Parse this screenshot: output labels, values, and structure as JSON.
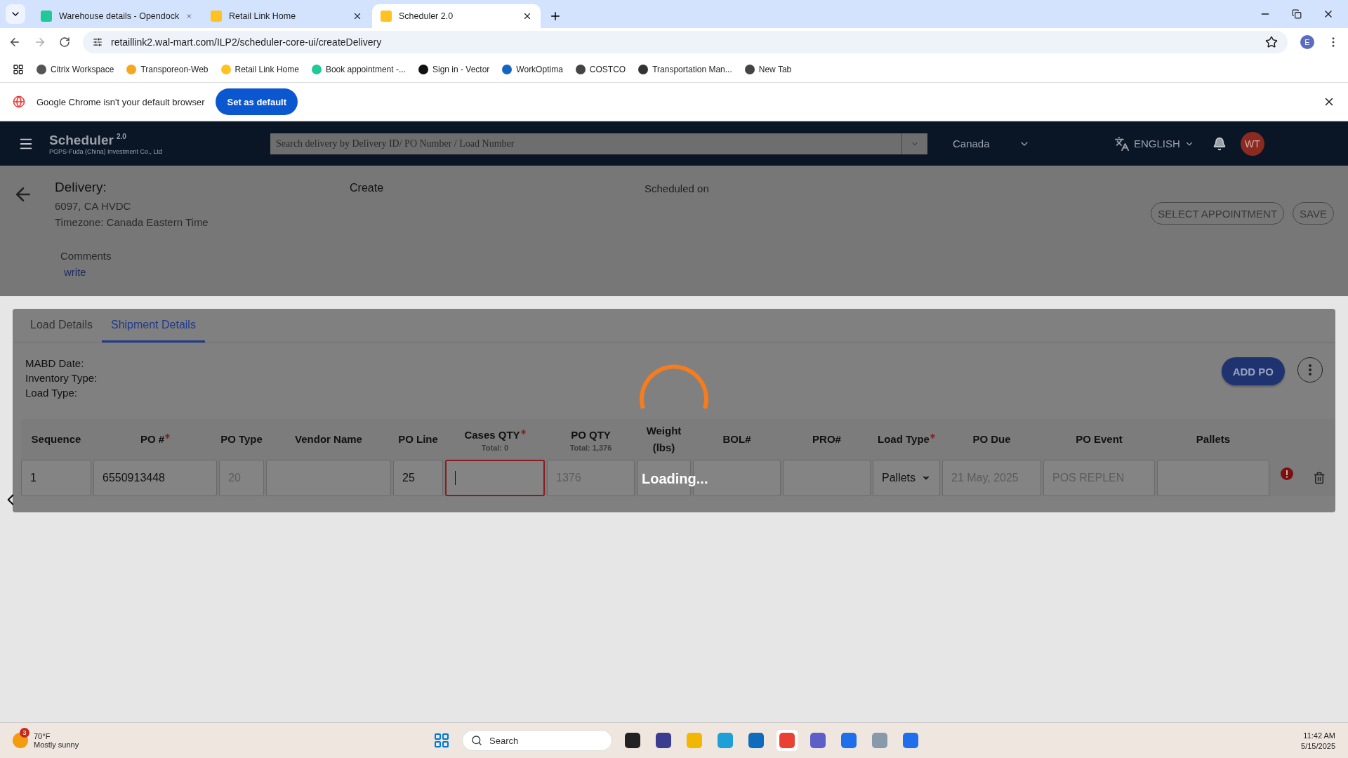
{
  "browser": {
    "tabs": [
      {
        "title": "Warehouse details - Opendock",
        "selected": false
      },
      {
        "title": "Retail Link Home",
        "selected": false
      },
      {
        "title": "Scheduler 2.0",
        "selected": true
      }
    ],
    "url": "retaillink2.wal-mart.com/ILP2/scheduler-core-ui/createDelivery",
    "bookmarks": [
      "Citrix Workspace",
      "Transporeon-Web",
      "Retail Link Home",
      "Book appointment -...",
      "Sign in - Vector",
      "WorkOptima",
      "COSTCO",
      "Transportation Man...",
      "New Tab"
    ],
    "infobar": {
      "message": "Google Chrome isn't your default browser",
      "button": "Set as default"
    },
    "profile": "E"
  },
  "header": {
    "brand": "Scheduler",
    "version": "2.0",
    "company": "PGPS-Fuda (China) Investment Co., Ltd",
    "search_placeholder": "Search delivery by Delivery ID/ PO Number / Load Number",
    "country": "Canada",
    "language": "ENGLISH",
    "avatar": "WT"
  },
  "delivery": {
    "title": "Delivery:",
    "location": "6097, CA HVDC",
    "timezone": "Timezone: Canada Eastern Time",
    "status": "Create",
    "scheduled": "Scheduled on",
    "buttons": [
      "SELECT APPOINTMENT",
      "SAVE"
    ],
    "comments_label": "Comments",
    "comments_link": "write"
  },
  "tabs": [
    {
      "label": "Load Details",
      "selected": false
    },
    {
      "label": "Shipment Details",
      "selected": true
    }
  ],
  "info": [
    "MABD Date:",
    "Inventory Type:",
    "Load Type:"
  ],
  "add_po": "ADD PO",
  "columns": [
    {
      "label": "Sequence",
      "required": false
    },
    {
      "label": "PO #",
      "required": true
    },
    {
      "label": "PO Type",
      "required": false
    },
    {
      "label": "Vendor Name",
      "required": false
    },
    {
      "label": "PO Line",
      "required": false
    },
    {
      "label": "Cases QTY",
      "required": true,
      "total": "Total: 0"
    },
    {
      "label": "PO QTY",
      "required": false,
      "total": "Total: 1,376"
    },
    {
      "label": "Weight (lbs)",
      "required": false
    },
    {
      "label": "BOL#",
      "required": false
    },
    {
      "label": "PRO#",
      "required": false
    },
    {
      "label": "Load Type",
      "required": true
    },
    {
      "label": "PO Due",
      "required": false
    },
    {
      "label": "PO Event",
      "required": false
    },
    {
      "label": "Pallets",
      "required": false
    }
  ],
  "row": [
    {
      "kind": "input",
      "value": "1"
    },
    {
      "kind": "input",
      "value": "6550913448"
    },
    {
      "kind": "disabled",
      "value": "20"
    },
    {
      "kind": "input"
    },
    {
      "kind": "input",
      "value": "25"
    },
    {
      "kind": "focused"
    },
    {
      "kind": "disabled",
      "value": "1376"
    },
    {
      "kind": "input"
    },
    {
      "kind": "input"
    },
    {
      "kind": "input"
    },
    {
      "kind": "select",
      "value": "Pallets"
    },
    {
      "kind": "disabled",
      "value": "21 May, 2025"
    },
    {
      "kind": "disabled",
      "value": "POS REPLEN"
    },
    {
      "kind": "input"
    }
  ],
  "loading": "Loading...",
  "taskbar": {
    "badge": "3",
    "temperature": "70°F",
    "weather": "Mostly sunny",
    "search": "Search",
    "time": "11:42 AM",
    "date": "5/15/2025"
  }
}
